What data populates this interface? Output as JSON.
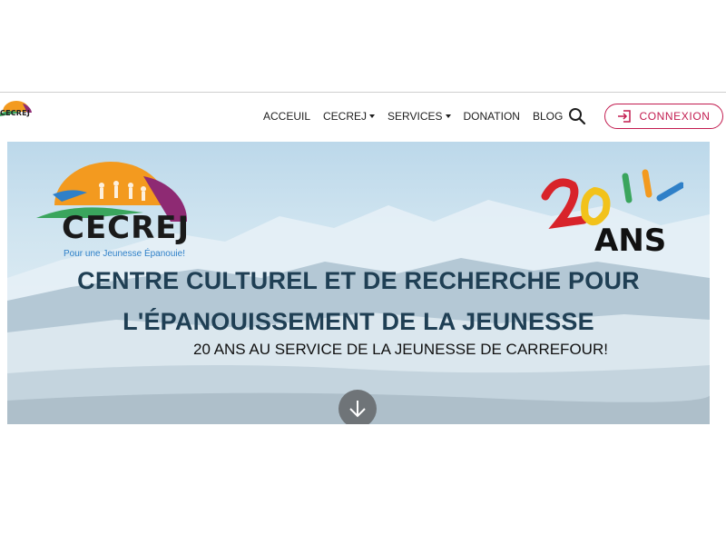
{
  "header": {
    "logo_text": "CECREJ",
    "nav": [
      {
        "label": "ACCEUIL",
        "dropdown": false
      },
      {
        "label": "CECREJ",
        "dropdown": true
      },
      {
        "label": "SERVICES",
        "dropdown": true
      },
      {
        "label": "DONATION",
        "dropdown": false
      },
      {
        "label": "BLOG",
        "dropdown": false
      }
    ],
    "search_icon": "search-icon",
    "login_label": "CONNEXION",
    "login_icon": "login-icon"
  },
  "hero": {
    "logo": {
      "name": "CECREJ",
      "tagline": "Pour une Jeunesse Épanouie!"
    },
    "anniversary": {
      "number": "20",
      "word": "ANS"
    },
    "title_line1": "CENTRE CULTUREL ET DE RECHERCHE POUR",
    "title_line2": "L'ÉPANOUISSEMENT DE LA JEUNESSE",
    "subtitle": "20 ANS AU SERVICE DE LA JEUNESSE DE CARREFOUR!",
    "scroll_icon": "arrow-down-icon"
  },
  "colors": {
    "accent": "#c21b4f",
    "title": "#1f3f54",
    "logo_orange": "#f39a1f",
    "logo_purple": "#8e2a73",
    "logo_green": "#3aa55d",
    "logo_blue": "#2f80c8",
    "logo_red": "#d8232a"
  }
}
